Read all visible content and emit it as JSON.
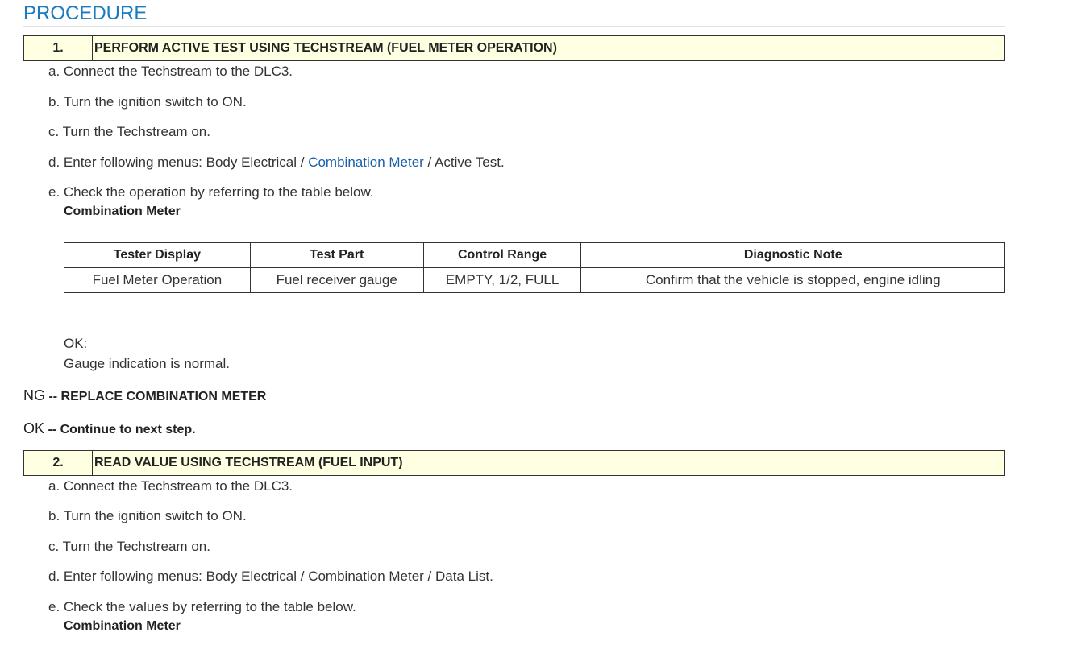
{
  "title": "PROCEDURE",
  "step1": {
    "number": "1.",
    "heading": "PERFORM ACTIVE TEST USING TECHSTREAM (FUEL METER OPERATION)",
    "items": [
      "a. Connect the Techstream to the DLC3.",
      "b. Turn the ignition switch to ON.",
      "c. Turn the Techstream on."
    ],
    "item_d_prefix": "d. Enter following menus: Body Electrical / ",
    "item_d_link": "Combination Meter",
    "item_d_suffix": " / Active Test.",
    "item_e": "e. Check the operation by referring to the table below.",
    "table_caption": "Combination Meter",
    "table": {
      "headers": [
        "Tester Display",
        "Test Part",
        "Control Range",
        "Diagnostic Note"
      ],
      "rows": [
        [
          "Fuel Meter Operation",
          "Fuel receiver gauge",
          "EMPTY, 1/2, FULL",
          "Confirm that the vehicle is stopped, engine idling"
        ]
      ]
    },
    "ok_label": "OK:",
    "ok_text": "Gauge indication is normal."
  },
  "results": {
    "ng_code": "NG",
    "ng_text": " -- REPLACE COMBINATION METER",
    "ok_code": "OK",
    "ok_text": " -- Continue to next step."
  },
  "step2": {
    "number": "2.",
    "heading": "READ VALUE USING TECHSTREAM (FUEL INPUT)",
    "items": [
      "a. Connect the Techstream to the DLC3.",
      "b. Turn the ignition switch to ON.",
      "c. Turn the Techstream on.",
      "d. Enter following menus: Body Electrical / Combination Meter / Data List.",
      "e. Check the values by referring to the table below."
    ],
    "table_caption": "Combination Meter"
  }
}
